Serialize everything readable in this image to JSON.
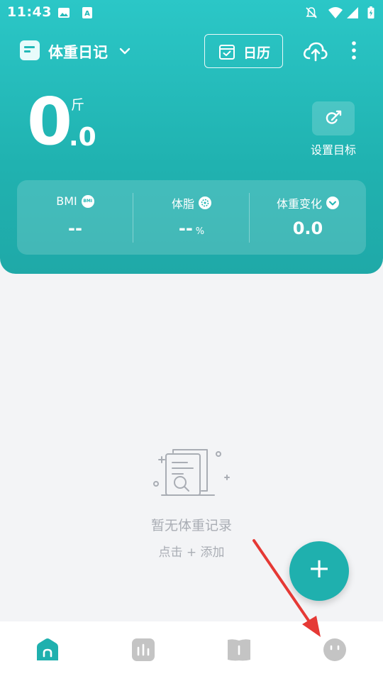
{
  "status_bar": {
    "time": "11:43",
    "icons": [
      "image-icon",
      "keyboard-a-icon",
      "notifications-off-icon",
      "wifi-icon",
      "signal-icon",
      "battery-charging-icon"
    ]
  },
  "header": {
    "app_title": "体重日记",
    "calendar_label": "日历",
    "weight_integer": "0",
    "weight_decimal": ".0",
    "weight_unit": "斤",
    "goal_label": "设置目标"
  },
  "stats": [
    {
      "label": "BMI",
      "badge": "BMI",
      "value": "--",
      "unit": ""
    },
    {
      "label": "体脂",
      "badge": "",
      "value": "--",
      "unit": "%"
    },
    {
      "label": "体重变化",
      "badge": "",
      "value": "0.0",
      "unit": ""
    }
  ],
  "empty_state": {
    "title": "暂无体重记录",
    "hint": "点击 + 添加"
  },
  "fab": {
    "label": "+"
  },
  "bottom_nav": {
    "items": [
      "home-icon",
      "stats-icon",
      "notebook-icon",
      "profile-icon"
    ],
    "active": "home-icon"
  },
  "colors": {
    "primary": "#20b2b0",
    "inactive": "#c4c4c4",
    "empty_text": "#a9adb4",
    "annotation_arrow": "#e53935"
  }
}
